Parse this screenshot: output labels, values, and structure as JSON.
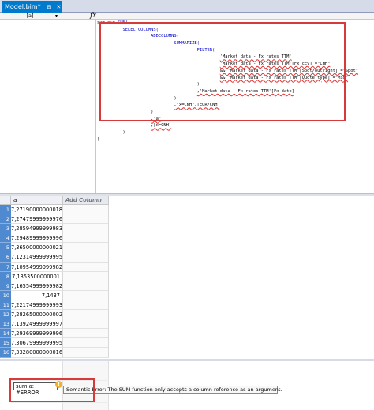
{
  "document_tab": {
    "title": "Model.bim*",
    "pin": "⊟",
    "close": "✕"
  },
  "formula_bar": {
    "name_box": "[a]",
    "fx": "fx"
  },
  "code_lines": [
    [
      {
        "t": "sum a:= ",
        "c": "plain"
      },
      {
        "t": "SUM(",
        "c": "kw"
      }
    ],
    [
      {
        "t": "          ",
        "c": "plain"
      },
      {
        "t": "SELECTCOLUMNS(",
        "c": "kw"
      }
    ],
    [
      {
        "t": "                     ",
        "c": "plain"
      },
      {
        "t": "ADDCOLUMNS(",
        "c": "kw"
      }
    ],
    [
      {
        "t": "                              ",
        "c": "plain"
      },
      {
        "t": "SUMMARIZE(",
        "c": "kw"
      }
    ],
    [
      {
        "t": "                                       ",
        "c": "plain"
      },
      {
        "t": "FILTER(",
        "c": "kw"
      }
    ],
    [
      {
        "t": "                                                ",
        "c": "plain"
      },
      {
        "t": "'Market data - Fx rates TTM'",
        "c": "ref"
      }
    ],
    [
      {
        "t": "                                                ",
        "c": "plain"
      },
      {
        "t": "'Market data - Fx rates TTM'[Fx ccy] =\"CNH\"",
        "c": "ref"
      }
    ],
    [
      {
        "t": "                                                ",
        "c": "plain"
      },
      {
        "t": "&& 'Market data - Fx rates TTM'[Spot/outright] =\"Spot\"",
        "c": "ref"
      }
    ],
    [
      {
        "t": "                                                ",
        "c": "plain"
      },
      {
        "t": "&& 'Market data - Fx rates TTM'[Quote type] =\"Mid\"",
        "c": "ref"
      }
    ],
    [
      {
        "t": "                                       ",
        "c": "plain"
      },
      {
        "t": ")",
        "c": "plain"
      }
    ],
    [
      {
        "t": "                                       ",
        "c": "plain"
      },
      {
        "t": ",'Market data - Fx rates TTM'[Fx date]",
        "c": "ref"
      }
    ],
    [
      {
        "t": "                              ",
        "c": "plain"
      },
      {
        "t": ")",
        "c": "plain"
      }
    ],
    [
      {
        "t": "                              ",
        "c": "plain"
      },
      {
        "t": ",\"x=CNH\",[EUR/CNH]",
        "c": "ref"
      }
    ],
    [
      {
        "t": "                     ",
        "c": "plain"
      },
      {
        "t": ")",
        "c": "plain"
      }
    ],
    [
      {
        "t": "                     ",
        "c": "plain"
      },
      {
        "t": ",\"a\"",
        "c": "ref"
      }
    ],
    [
      {
        "t": "                     ",
        "c": "plain"
      },
      {
        "t": ",[x=CNH]",
        "c": "ref"
      }
    ],
    [
      {
        "t": "          ",
        "c": "plain"
      },
      {
        "t": ")",
        "c": "plain"
      }
    ],
    [
      {
        "t": ")",
        "c": "plain"
      }
    ]
  ],
  "grid": {
    "column_header": "a",
    "add_column_label": "Add Column",
    "rows": [
      {
        "n": "1",
        "v": "7,27190000000018"
      },
      {
        "n": "2",
        "v": "7,27479999999976"
      },
      {
        "n": "3",
        "v": "7,28594999999983"
      },
      {
        "n": "4",
        "v": "7,29489999999996"
      },
      {
        "n": "5",
        "v": "7,36500000000021"
      },
      {
        "n": "6",
        "v": "7,12314999999995"
      },
      {
        "n": "7",
        "v": "7,10954999999982"
      },
      {
        "n": "8",
        "v": "7,1353500000001"
      },
      {
        "n": "9",
        "v": "7,16554999999982"
      },
      {
        "n": "10",
        "v": "7,1437"
      },
      {
        "n": "11",
        "v": "7,22174999999993"
      },
      {
        "n": "12",
        "v": "7,28265000000002"
      },
      {
        "n": "13",
        "v": "7,13924999999997"
      },
      {
        "n": "14",
        "v": "7,29369999999996"
      },
      {
        "n": "15",
        "v": "7,30679999999995"
      },
      {
        "n": "16",
        "v": "7,33280000000016"
      }
    ]
  },
  "measure": {
    "cell_text": "sum a:  #ERROR",
    "warning_glyph": "!",
    "tooltip": "Semantic Error: The SUM function only accepts a column reference as an argument."
  }
}
